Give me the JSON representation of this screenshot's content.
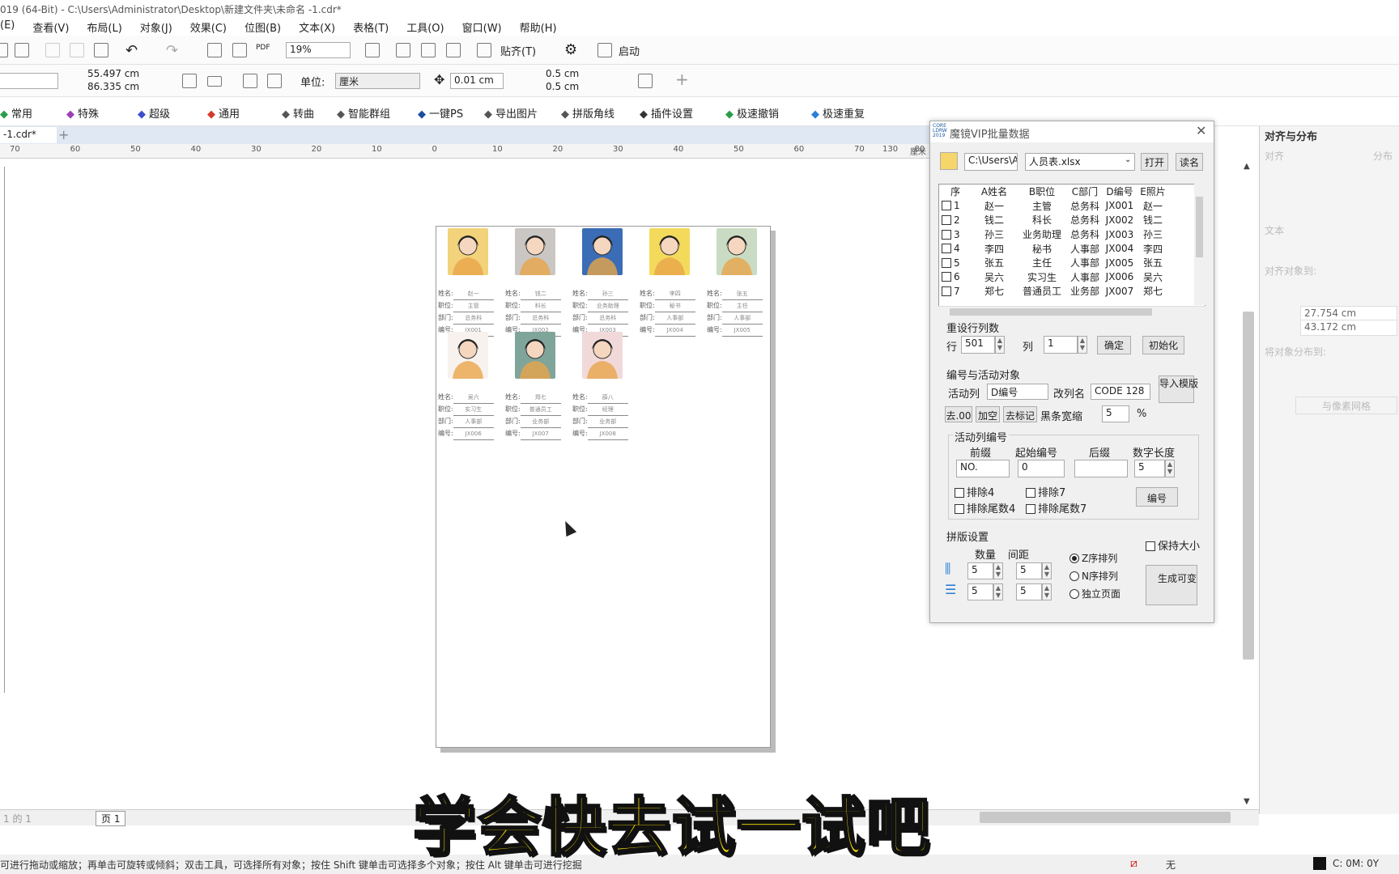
{
  "window": {
    "title": "019 (64-Bit) - C:\\Users\\Administrator\\Desktop\\新建文件夹\\未命名 -1.cdr*"
  },
  "menu": [
    "(E)",
    "查看(V)",
    "布局(L)",
    "对象(J)",
    "效果(C)",
    "位图(B)",
    "文本(X)",
    "表格(T)",
    "工具(O)",
    "窗口(W)",
    "帮助(H)"
  ],
  "toolbar": {
    "zoom": "19%",
    "snap_label": "贴齐(T)",
    "launch_label": "启动"
  },
  "propbar": {
    "width": "55.497 cm",
    "height": "86.335 cm",
    "unit_label": "单位:",
    "unit_value": "厘米",
    "nudge": "0.01 cm",
    "dup_x": "0.5 cm",
    "dup_y": "0.5 cm"
  },
  "plugin_bar": [
    "常用",
    "特殊",
    "超级",
    "通用",
    "转曲",
    "智能群组",
    "一键PS",
    "导出图片",
    "拼版角线",
    "插件设置",
    "极速撤销",
    "极速重复"
  ],
  "doc_tab": "-1.cdr*",
  "ruler_labels": [
    "70",
    "60",
    "50",
    "40",
    "30",
    "20",
    "10",
    "0",
    "10",
    "20",
    "30",
    "40",
    "50",
    "60",
    "70",
    "80"
  ],
  "ruler_tail": {
    "l1": "130",
    "l2": "厘米"
  },
  "cards": [
    {
      "name": "赵一",
      "pos": "主管",
      "dept": "总务科",
      "code": "JX001",
      "color": "#f2d27a"
    },
    {
      "name": "钱二",
      "pos": "科长",
      "dept": "总务科",
      "code": "JX002",
      "color": "#c9c6c3"
    },
    {
      "name": "孙三",
      "pos": "业务助理",
      "dept": "总务科",
      "code": "JX003",
      "color": "#3a6db5"
    },
    {
      "name": "李四",
      "pos": "秘书",
      "dept": "人事部",
      "code": "JX004",
      "color": "#f3da5b"
    },
    {
      "name": "张五",
      "pos": "主任",
      "dept": "人事部",
      "code": "JX005",
      "color": "#c9dcc3"
    },
    {
      "name": "吴六",
      "pos": "实习生",
      "dept": "人事部",
      "code": "JX006",
      "color": "#f7f2ee"
    },
    {
      "name": "郑七",
      "pos": "普通员工",
      "dept": "业务部",
      "code": "JX007",
      "color": "#7fa59b"
    },
    {
      "name": "薛八",
      "pos": "经理",
      "dept": "业务部",
      "code": "JX008",
      "color": "#f1d9da"
    }
  ],
  "card_labels": {
    "name": "姓名:",
    "pos": "职位:",
    "dept": "部门:",
    "code": "编号:"
  },
  "dialog": {
    "title": "魔镜VIP批量数据",
    "path": "C:\\Users\\Adr",
    "file": "人员表.xlsx",
    "open": "打开",
    "read_name": "读名",
    "columns": [
      "序",
      "A姓名",
      "B职位",
      "C部门",
      "D编号",
      "E照片"
    ],
    "rows": [
      [
        "1",
        "赵一",
        "主管",
        "总务科",
        "JX001",
        "赵一"
      ],
      [
        "2",
        "钱二",
        "科长",
        "总务科",
        "JX002",
        "钱二"
      ],
      [
        "3",
        "孙三",
        "业务助理",
        "总务科",
        "JX003",
        "孙三"
      ],
      [
        "4",
        "李四",
        "秘书",
        "人事部",
        "JX004",
        "李四"
      ],
      [
        "5",
        "张五",
        "主任",
        "人事部",
        "JX005",
        "张五"
      ],
      [
        "6",
        "吴六",
        "实习生",
        "人事部",
        "JX006",
        "吴六"
      ],
      [
        "7",
        "郑七",
        "普通员工",
        "业务部",
        "JX007",
        "郑七"
      ]
    ],
    "reset_group": "重设行列数",
    "row_label": "行",
    "row_value": "501",
    "col_label": "列",
    "col_value": "1",
    "confirm": "确定",
    "init": "初始化",
    "code_group": "编号与活动对象",
    "active_col_label": "活动列",
    "active_col": "D编号",
    "rename_label": "改列名",
    "barcode": "CODE 128",
    "import_template": "导入模版",
    "remove_00": "去.00",
    "add_space": "加空",
    "remove_mark": "去标记",
    "bar_width_label": "黑条宽缩",
    "bar_width": "5",
    "percent": "%",
    "active_code_group": "活动列编号",
    "prefix_label": "前缀",
    "start_label": "起始编号",
    "suffix_label": "后缀",
    "digits_label": "数字长度",
    "prefix": "NO.",
    "start": "0",
    "suffix": "",
    "digits": "5",
    "ex4": "排除4",
    "ex7": "排除7",
    "extail4": "排除尾数4",
    "extail7": "排除尾数7",
    "number_btn": "编号",
    "imposition_group": "拼版设置",
    "keep_size": "保持大小",
    "qty_label": "数量",
    "gap_label": "间距",
    "qty1": "5",
    "gap1": "5",
    "qty2": "5",
    "gap2": "5",
    "z_order": "Z序排列",
    "n_order": "N序排列",
    "single_page": "独立页面",
    "generate": "生成可变"
  },
  "right_panel": {
    "title": "对齐与分布",
    "align": "对齐",
    "distribute": "分布",
    "text": "文本",
    "align_to": "对齐对象到:",
    "x": "27.754 cm",
    "y": "43.172 cm",
    "dist_to": "将对象分布到:",
    "pixel_grid": "与像素网格"
  },
  "page_nav": {
    "counter": "1 的 1",
    "page_tab": "页 1"
  },
  "status": {
    "hint": "可进行拖动或缩放；再单击可旋转或倾斜；双击工具，可选择所有对象；按住 Shift 键单击可选择多个对象；按住 Alt 键单击可进行挖掘",
    "fill": "无",
    "color": "C: 0M: 0Y"
  },
  "subtitle": "学会快去试一试吧"
}
